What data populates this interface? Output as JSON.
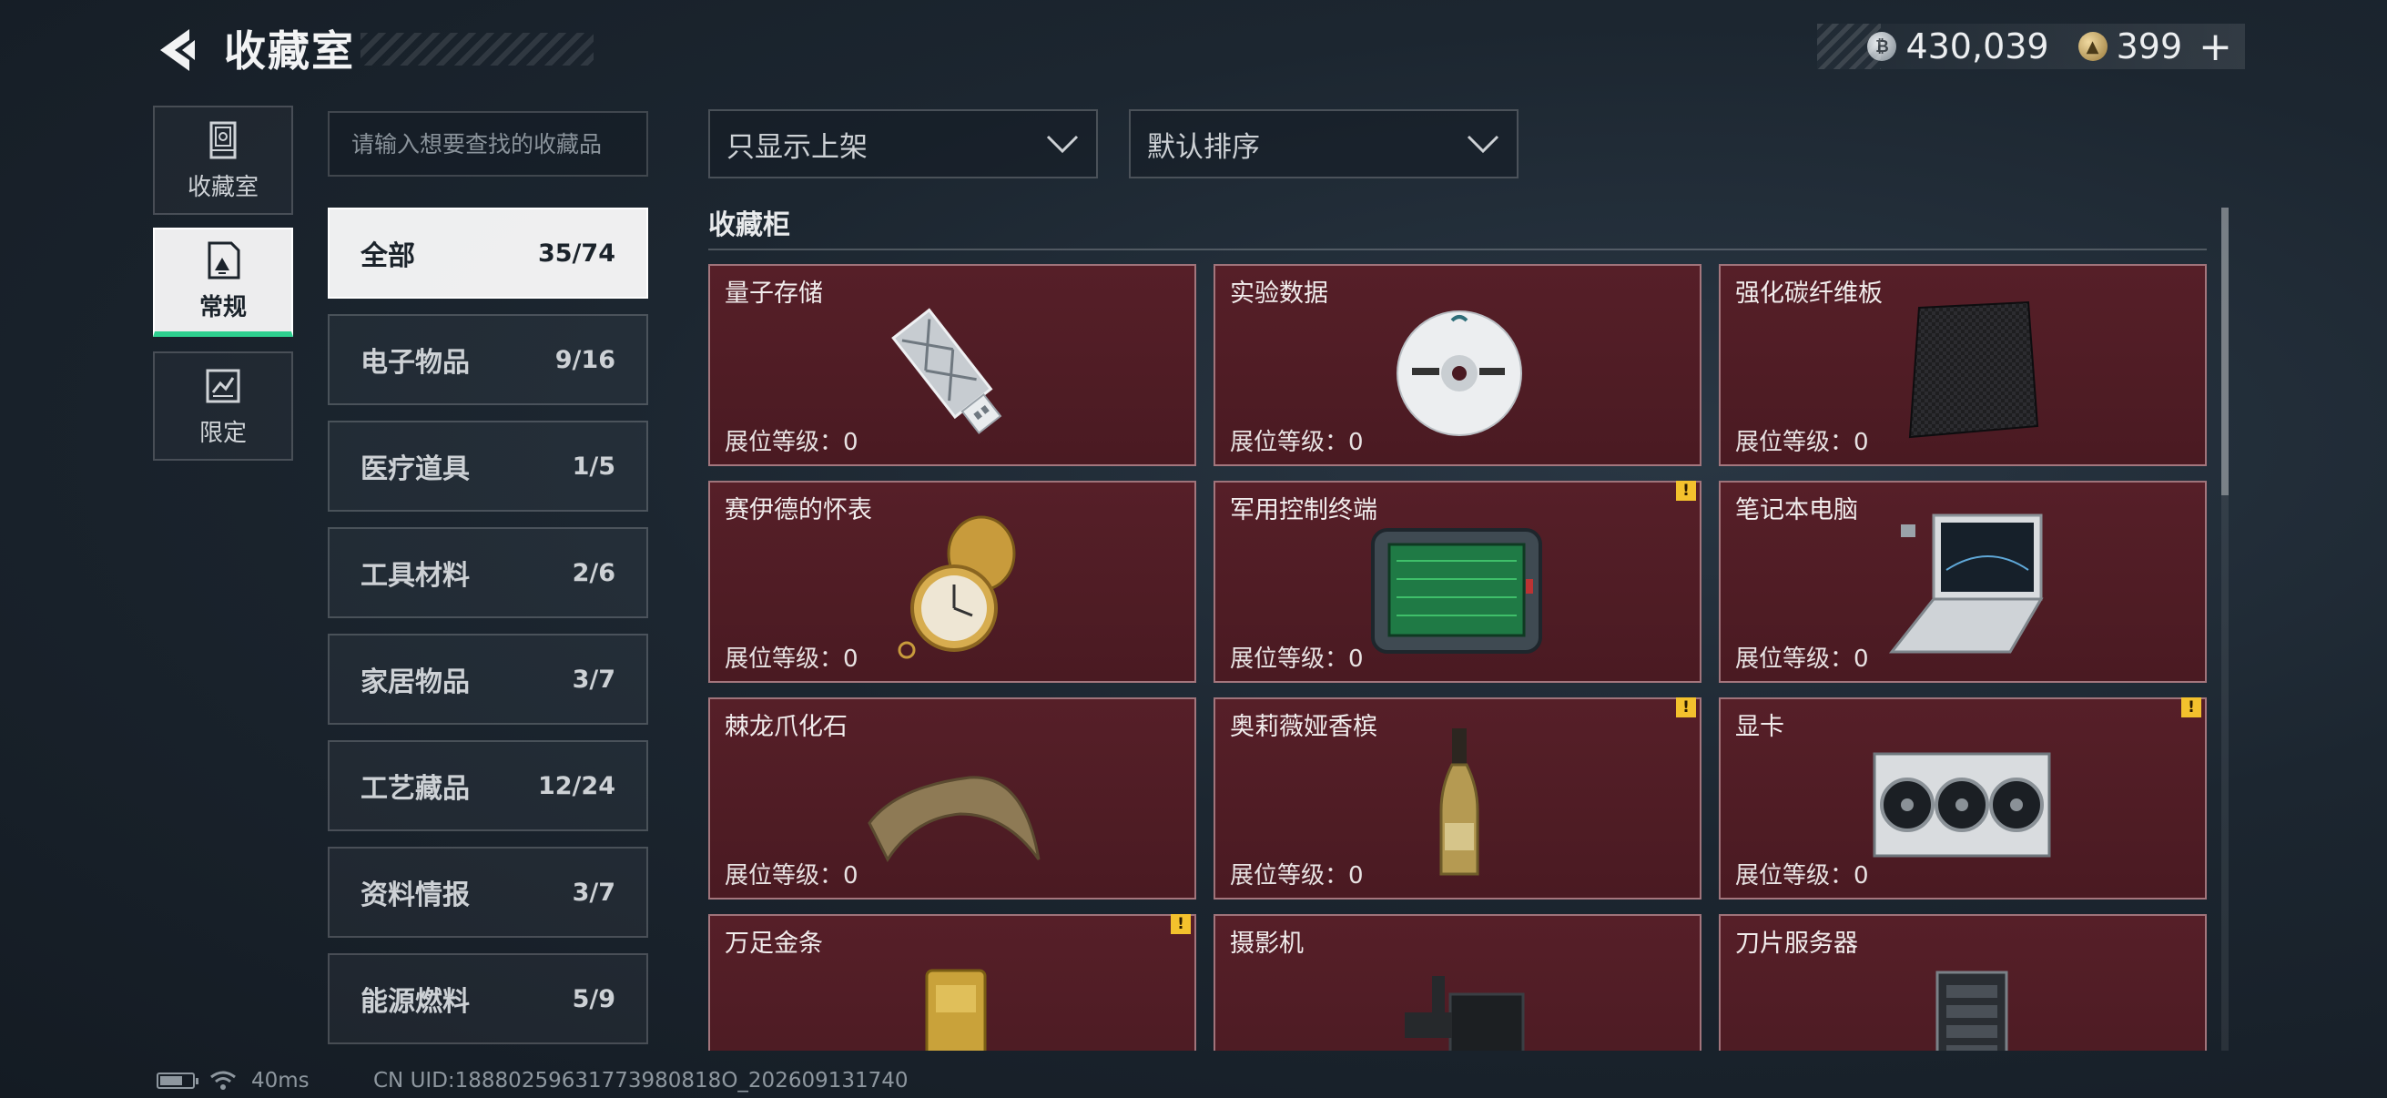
{
  "header": {
    "title": "收藏室"
  },
  "currency": {
    "silver_value": "430,039",
    "gold_value": "399",
    "plus_label": "+"
  },
  "nav": [
    {
      "label": "收藏室",
      "icon": "storage-cabinet-icon",
      "active": false
    },
    {
      "label": "常规",
      "icon": "document-icon",
      "active": true
    },
    {
      "label": "限定",
      "icon": "limited-card-icon",
      "active": false
    }
  ],
  "search": {
    "placeholder": "请输入想要查找的收藏品"
  },
  "categories": [
    {
      "name": "全部",
      "count": "35/74",
      "active": true
    },
    {
      "name": "电子物品",
      "count": "9/16"
    },
    {
      "name": "医疗道具",
      "count": "1/5"
    },
    {
      "name": "工具材料",
      "count": "2/6"
    },
    {
      "name": "家居物品",
      "count": "3/7"
    },
    {
      "name": "工艺藏品",
      "count": "12/24"
    },
    {
      "name": "资料情报",
      "count": "3/7"
    },
    {
      "name": "能源燃料",
      "count": "5/9"
    }
  ],
  "filters": {
    "display": "只显示上架",
    "sort": "默认排序"
  },
  "section": {
    "title": "收藏柜"
  },
  "items": [
    {
      "name": "量子存储",
      "level": "展位等级：0",
      "icon": "usb-drive-icon",
      "alert": false
    },
    {
      "name": "实验数据",
      "level": "展位等级：0",
      "icon": "disc-icon",
      "alert": false
    },
    {
      "name": "强化碳纤维板",
      "level": "展位等级：0",
      "icon": "carbon-plate-icon",
      "alert": false
    },
    {
      "name": "赛伊德的怀表",
      "level": "展位等级：0",
      "icon": "pocket-watch-icon",
      "alert": false
    },
    {
      "name": "军用控制终端",
      "level": "展位等级：0",
      "icon": "control-terminal-icon",
      "alert": true
    },
    {
      "name": "笔记本电脑",
      "level": "展位等级：0",
      "icon": "laptop-icon",
      "alert": false
    },
    {
      "name": "棘龙爪化石",
      "level": "展位等级：0",
      "icon": "claw-fossil-icon",
      "alert": false
    },
    {
      "name": "奥莉薇娅香槟",
      "level": "展位等级：0",
      "icon": "champagne-icon",
      "alert": true
    },
    {
      "name": "显卡",
      "level": "展位等级：0",
      "icon": "graphics-card-icon",
      "alert": true
    },
    {
      "name": "万足金条",
      "level": "",
      "icon": "gold-bar-icon",
      "alert": true
    },
    {
      "name": "摄影机",
      "level": "",
      "icon": "video-camera-icon",
      "alert": false
    },
    {
      "name": "刀片服务器",
      "level": "",
      "icon": "server-icon",
      "alert": false
    }
  ],
  "alert_mark": "!",
  "status": {
    "ping": "40ms",
    "uid": "CN UID:18880259631773980818O_202609131740"
  }
}
